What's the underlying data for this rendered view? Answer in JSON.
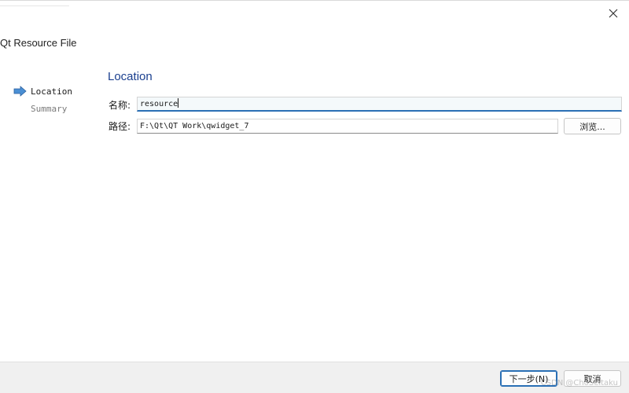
{
  "window": {
    "page_title": "Qt Resource File",
    "close_glyph": "✕"
  },
  "steps": [
    {
      "label": "Location",
      "state": "current"
    },
    {
      "label": "Summary",
      "state": "pending"
    }
  ],
  "section": {
    "heading": "Location"
  },
  "form": {
    "name_label": "名称:",
    "name_value": "resource",
    "path_label": "路径:",
    "path_value": "F:\\Qt\\QT Work\\qwidget_7",
    "browse_label": "浏览..."
  },
  "footer": {
    "next_label": "下一步(N)",
    "cancel_label": "取消"
  },
  "watermark": "CSDN @ChoSeitaku",
  "colors": {
    "accent": "#2a6fb5",
    "heading": "#1a3f8f",
    "arrow": "#4a8fd4"
  },
  "icons": {
    "close": "close-icon",
    "current_step": "arrow-right-icon"
  }
}
